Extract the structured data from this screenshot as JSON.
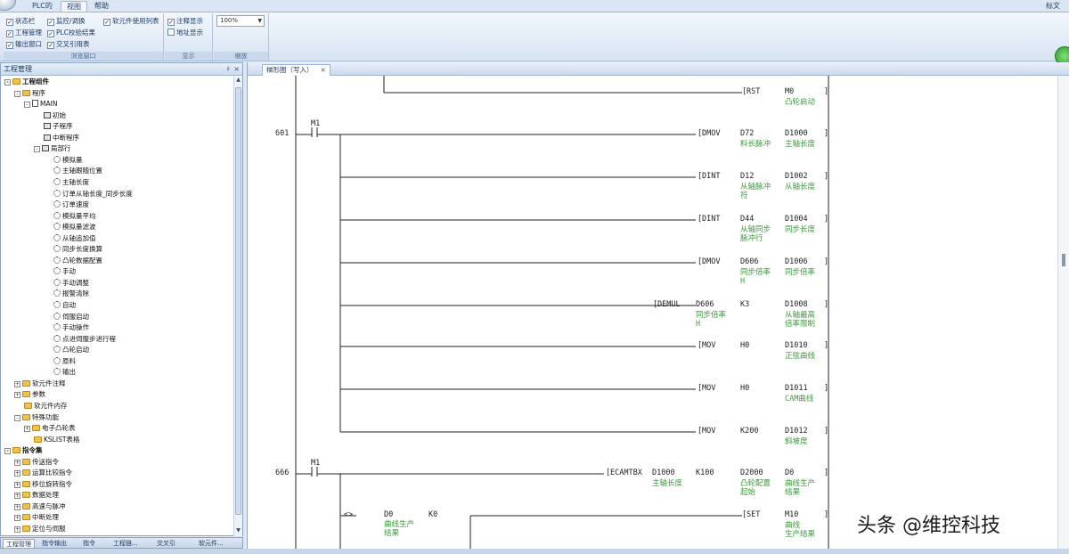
{
  "menu": {
    "tabs": [
      "PLC的",
      "视图",
      "帮助"
    ],
    "active": 1,
    "right": "标文"
  },
  "ribbon": {
    "window_group": {
      "title": "浏览窗口",
      "items": [
        {
          "label": "状态栏",
          "checked": true
        },
        {
          "label": "工程管理",
          "checked": true
        },
        {
          "label": "输出窗口",
          "checked": true
        },
        {
          "label": "监控/调换",
          "checked": true
        },
        {
          "label": "PLC校验结果",
          "checked": true
        },
        {
          "label": "交叉引用表",
          "checked": true
        },
        {
          "label": "软元件使用列表",
          "checked": true
        }
      ]
    },
    "display_group": {
      "title": "显示",
      "items": [
        {
          "label": "注释显示",
          "checked": true
        },
        {
          "label": "地址显示",
          "checked": false
        }
      ]
    },
    "zoom_group": {
      "title": "缩放",
      "value": "100%"
    }
  },
  "project_panel": {
    "title": "工程管理",
    "tree": [
      {
        "level": 0,
        "label": "工程组件",
        "icon": "folder",
        "exp": "-",
        "bold": true
      },
      {
        "level": 1,
        "label": "程序",
        "icon": "folder",
        "exp": "-"
      },
      {
        "level": 2,
        "label": "MAIN",
        "icon": "page",
        "exp": "-"
      },
      {
        "level": 3,
        "label": "初始",
        "icon": "prog"
      },
      {
        "level": 3,
        "label": "子程序",
        "icon": "prog"
      },
      {
        "level": 3,
        "label": "中断程序",
        "icon": "prog"
      },
      {
        "level": 3,
        "label": "局部行",
        "icon": "prog",
        "exp": "-"
      },
      {
        "level": 4,
        "label": "模拟量",
        "icon": "step"
      },
      {
        "level": 4,
        "label": "主轴跟随位置",
        "icon": "step"
      },
      {
        "level": 4,
        "label": "主轴长度",
        "icon": "step"
      },
      {
        "level": 4,
        "label": "订单从轴长度_同步长度",
        "icon": "step"
      },
      {
        "level": 4,
        "label": "订单速度",
        "icon": "step"
      },
      {
        "level": 4,
        "label": "模拟量平均",
        "icon": "step"
      },
      {
        "level": 4,
        "label": "模拟量滤波",
        "icon": "step"
      },
      {
        "level": 4,
        "label": "从轴追加值",
        "icon": "step"
      },
      {
        "level": 4,
        "label": "同步长度换算",
        "icon": "step"
      },
      {
        "level": 4,
        "label": "凸轮数据配置",
        "icon": "step"
      },
      {
        "level": 4,
        "label": "手动",
        "icon": "step"
      },
      {
        "level": 4,
        "label": "手动调整",
        "icon": "step"
      },
      {
        "level": 4,
        "label": "报警清除",
        "icon": "step"
      },
      {
        "level": 4,
        "label": "自动",
        "icon": "step"
      },
      {
        "level": 4,
        "label": "伺服启动",
        "icon": "step"
      },
      {
        "level": 4,
        "label": "手动操作",
        "icon": "step"
      },
      {
        "level": 4,
        "label": "点进伺服步进行程",
        "icon": "step"
      },
      {
        "level": 4,
        "label": "凸轮启动",
        "icon": "step"
      },
      {
        "level": 4,
        "label": "原料",
        "icon": "step"
      },
      {
        "level": 4,
        "label": "输出",
        "icon": "step"
      },
      {
        "level": 1,
        "label": "软元件注释",
        "icon": "folder",
        "exp": "+"
      },
      {
        "level": 1,
        "label": "参数",
        "icon": "folder",
        "exp": "+"
      },
      {
        "level": 1,
        "label": "软元件内存",
        "icon": "folder"
      },
      {
        "level": 1,
        "label": "特殊功能",
        "icon": "folder",
        "exp": "-"
      },
      {
        "level": 2,
        "label": "电子凸轮表",
        "icon": "folder",
        "exp": "+"
      },
      {
        "level": 2,
        "label": "KSLIST表格",
        "icon": "folder"
      },
      {
        "level": 0,
        "label": "指令集",
        "icon": "folder",
        "exp": "-",
        "bold": true
      },
      {
        "level": 1,
        "label": "传送指令",
        "icon": "folder",
        "exp": "+"
      },
      {
        "level": 1,
        "label": "运算比较指令",
        "icon": "folder",
        "exp": "+"
      },
      {
        "level": 1,
        "label": "移位旋转指令",
        "icon": "folder",
        "exp": "+"
      },
      {
        "level": 1,
        "label": "数据处理",
        "icon": "folder",
        "exp": "+"
      },
      {
        "level": 1,
        "label": "高速与脉冲",
        "icon": "folder",
        "exp": "+"
      },
      {
        "level": 1,
        "label": "中断处理",
        "icon": "folder",
        "exp": "+"
      },
      {
        "level": 1,
        "label": "定位与伺服",
        "icon": "folder",
        "exp": "+"
      }
    ],
    "bottom_tabs": [
      "工程管理",
      "指令输出",
      "指令",
      "工程链...",
      "交叉引",
      "软元件..."
    ]
  },
  "document": {
    "tab_label": "梯形图（写入）",
    "rows": [
      {
        "step": "",
        "contact": "",
        "instr": "RST",
        "op1": "M0",
        "op1c": "凸轮启动",
        "op2": "",
        "op2c": "",
        "op3": "",
        "op3c": ""
      },
      {
        "step": "601",
        "contact": "M1",
        "instr": "DMOV",
        "op1": "D72",
        "op1c": "料长脉冲",
        "op2": "D1000",
        "op2c": "主轴长度",
        "op3": "",
        "op3c": ""
      },
      {
        "step": "",
        "contact": "",
        "instr": "DINT",
        "op1": "D12",
        "op1c": "从轴脉冲\n符",
        "op2": "D1002",
        "op2c": "从轴长度",
        "op3": "",
        "op3c": ""
      },
      {
        "step": "",
        "contact": "",
        "instr": "DINT",
        "op1": "D44",
        "op1c": "从轴同步\n脉冲行",
        "op2": "D1004",
        "op2c": "同步长度",
        "op3": "",
        "op3c": ""
      },
      {
        "step": "",
        "contact": "",
        "instr": "DMOV",
        "op1": "D606",
        "op1c": "同步倍率\nH",
        "op2": "D1006",
        "op2c": "同步倍率",
        "op3": "",
        "op3c": ""
      },
      {
        "step": "",
        "contact": "",
        "instr": "DEMUL",
        "op1": "D606",
        "op1c": "同步倍率\nH",
        "op2": "K3",
        "op2c": "",
        "op3": "D1008",
        "op3c": "从轴最高\n倍率限制"
      },
      {
        "step": "",
        "contact": "",
        "instr": "MOV",
        "op1": "H0",
        "op1c": "",
        "op2": "D1010",
        "op2c": "正弦曲线",
        "op3": "",
        "op3c": ""
      },
      {
        "step": "",
        "contact": "",
        "instr": "MOV",
        "op1": "H0",
        "op1c": "",
        "op2": "D1011",
        "op2c": "CAM曲线",
        "op3": "",
        "op3c": ""
      },
      {
        "step": "",
        "contact": "",
        "instr": "MOV",
        "op1": "K200",
        "op1c": "",
        "op2": "D1012",
        "op2c": "斜坡度",
        "op3": "",
        "op3c": ""
      },
      {
        "step": "666",
        "contact": "M1",
        "instr": "ECAMTBX",
        "op1": "D1000",
        "op1c": "主轴长度",
        "op2": "K100",
        "op2c": "",
        "op3": "D2000",
        "op3c": "凸轮配置\n起始",
        "op4": "D0",
        "op4c": "曲线生产\n结果"
      },
      {
        "step": "",
        "contact": "",
        "instr": "SET",
        "cmp": "<>",
        "cmp_a": "D0",
        "cmp_ac": "曲线生产\n结果",
        "cmp_b": "K0",
        "op1": "M10",
        "op1c": "曲线\n生产结果"
      }
    ]
  },
  "watermark": "头条 @维控科技"
}
